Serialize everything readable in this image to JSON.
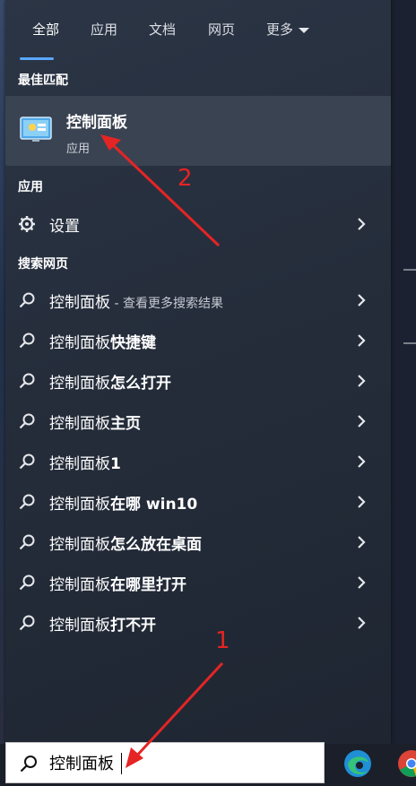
{
  "tabs": [
    {
      "label": "全部"
    },
    {
      "label": "应用"
    },
    {
      "label": "文档"
    },
    {
      "label": "网页"
    },
    {
      "label": "更多"
    }
  ],
  "sections": {
    "best_match": "最佳匹配",
    "apps": "应用",
    "web_search": "搜索网页"
  },
  "best_match": {
    "name": "控制面板",
    "type": "应用",
    "icon": "control-panel-icon"
  },
  "apps": [
    {
      "label": "设置",
      "icon": "gear-icon"
    }
  ],
  "web_results": [
    {
      "prefix": "控制面板",
      "suffix": "",
      "sub": " - 查看更多搜索结果"
    },
    {
      "prefix": "控制面板",
      "suffix": "快捷键",
      "sub": ""
    },
    {
      "prefix": "控制面板",
      "suffix": "怎么打开",
      "sub": ""
    },
    {
      "prefix": "控制面板",
      "suffix": "主页",
      "sub": ""
    },
    {
      "prefix": "控制面板",
      "suffix": "1",
      "sub": ""
    },
    {
      "prefix": "控制面板",
      "suffix": "在哪 win10",
      "sub": ""
    },
    {
      "prefix": "控制面板",
      "suffix": "怎么放在桌面",
      "sub": ""
    },
    {
      "prefix": "控制面板",
      "suffix": "在哪里打开",
      "sub": ""
    },
    {
      "prefix": "控制面板",
      "suffix": "打不开",
      "sub": ""
    }
  ],
  "search": {
    "value": "控制面板"
  },
  "annotations": {
    "one": "1",
    "two": "2"
  },
  "colors": {
    "accent": "#5aa7ff",
    "annotation": "#e52424"
  }
}
